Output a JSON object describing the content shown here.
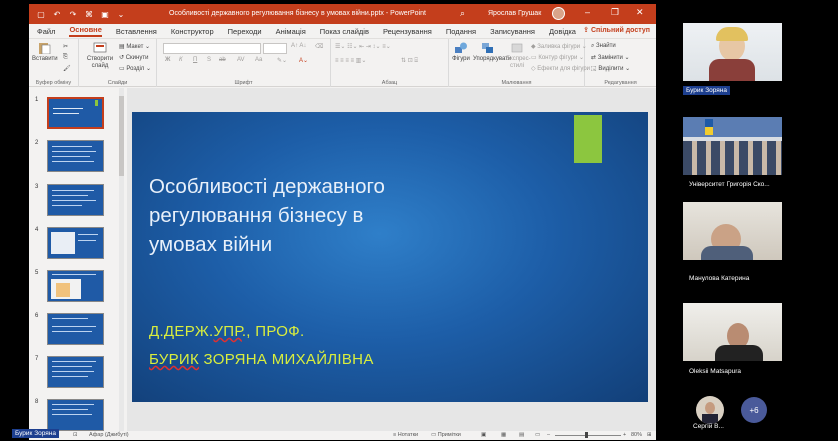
{
  "app": {
    "doc_title": "Особливості державного регулювання бізнесу в умовах війни.pptx",
    "app_name": "PowerPoint",
    "user_name": "Ярослав Грушак",
    "share_label": "Спільний доступ",
    "colors": {
      "titlebar": "#c43e1c",
      "slide_bg": "#1d5ea8",
      "accent": "#8cc63f",
      "author_text": "#d9ee3d"
    }
  },
  "menu": {
    "items": [
      "Файл",
      "Основне",
      "Вставлення",
      "Конструктор",
      "Переходи",
      "Анімація",
      "Показ слайдів",
      "Рецензування",
      "Подання",
      "Записування",
      "Довідка"
    ],
    "active_index": 1
  },
  "ribbon": {
    "paste": "Вставити",
    "new_slide": "Створити слайд",
    "layout": "Макет",
    "reset": "Скинути",
    "section": "Розділ",
    "shapes": "Фігури",
    "arrange": "Упорядкувати",
    "quick_styles": "Експрес-стилі",
    "fill": "Заливка фігури",
    "outline": "Контур фігури",
    "effects": "Ефекти для фігури",
    "find": "Знайти",
    "replace": "Замінити",
    "select": "Виділити",
    "groups": {
      "clipboard": "Буфер обміну",
      "slides": "Слайди",
      "font": "Шрифт",
      "paragraph": "Абзац",
      "drawing": "Малювання",
      "editing": "Редагування"
    },
    "font_buttons": [
      "Ж",
      "К",
      "П",
      "S",
      "ab",
      "AV",
      "Aa"
    ]
  },
  "thumbnails": [
    {
      "num": "1"
    },
    {
      "num": "2"
    },
    {
      "num": "3"
    },
    {
      "num": "4"
    },
    {
      "num": "5"
    },
    {
      "num": "6"
    },
    {
      "num": "7"
    },
    {
      "num": "8"
    }
  ],
  "slide": {
    "title_lines": [
      "Особливості державного",
      "регулювання бізнесу в",
      "умовах війни"
    ],
    "author_line1_prefix": "Д.ДЕРЖ.",
    "author_line1_ul": "УПР",
    "author_line1_suffix": "., ПРОФ.",
    "author_line2_ul": "БУРИК",
    "author_line2_rest": " ЗОРЯНА МИХАЙЛІВНА"
  },
  "status": {
    "theme": "Афар (Джибуті)",
    "notes": "Нотатки",
    "comments": "Примітки",
    "zoom": "80%",
    "speaker_overlay": "Бурик Зоряна"
  },
  "participants": [
    {
      "name": "Бурик Зоряна"
    },
    {
      "name": "Університет Григорія Ско..."
    },
    {
      "name": "Манулова Катерина"
    },
    {
      "name": "Oleksii Matsapura"
    },
    {
      "name": "Сергій В..."
    }
  ],
  "more_participants": "+6"
}
